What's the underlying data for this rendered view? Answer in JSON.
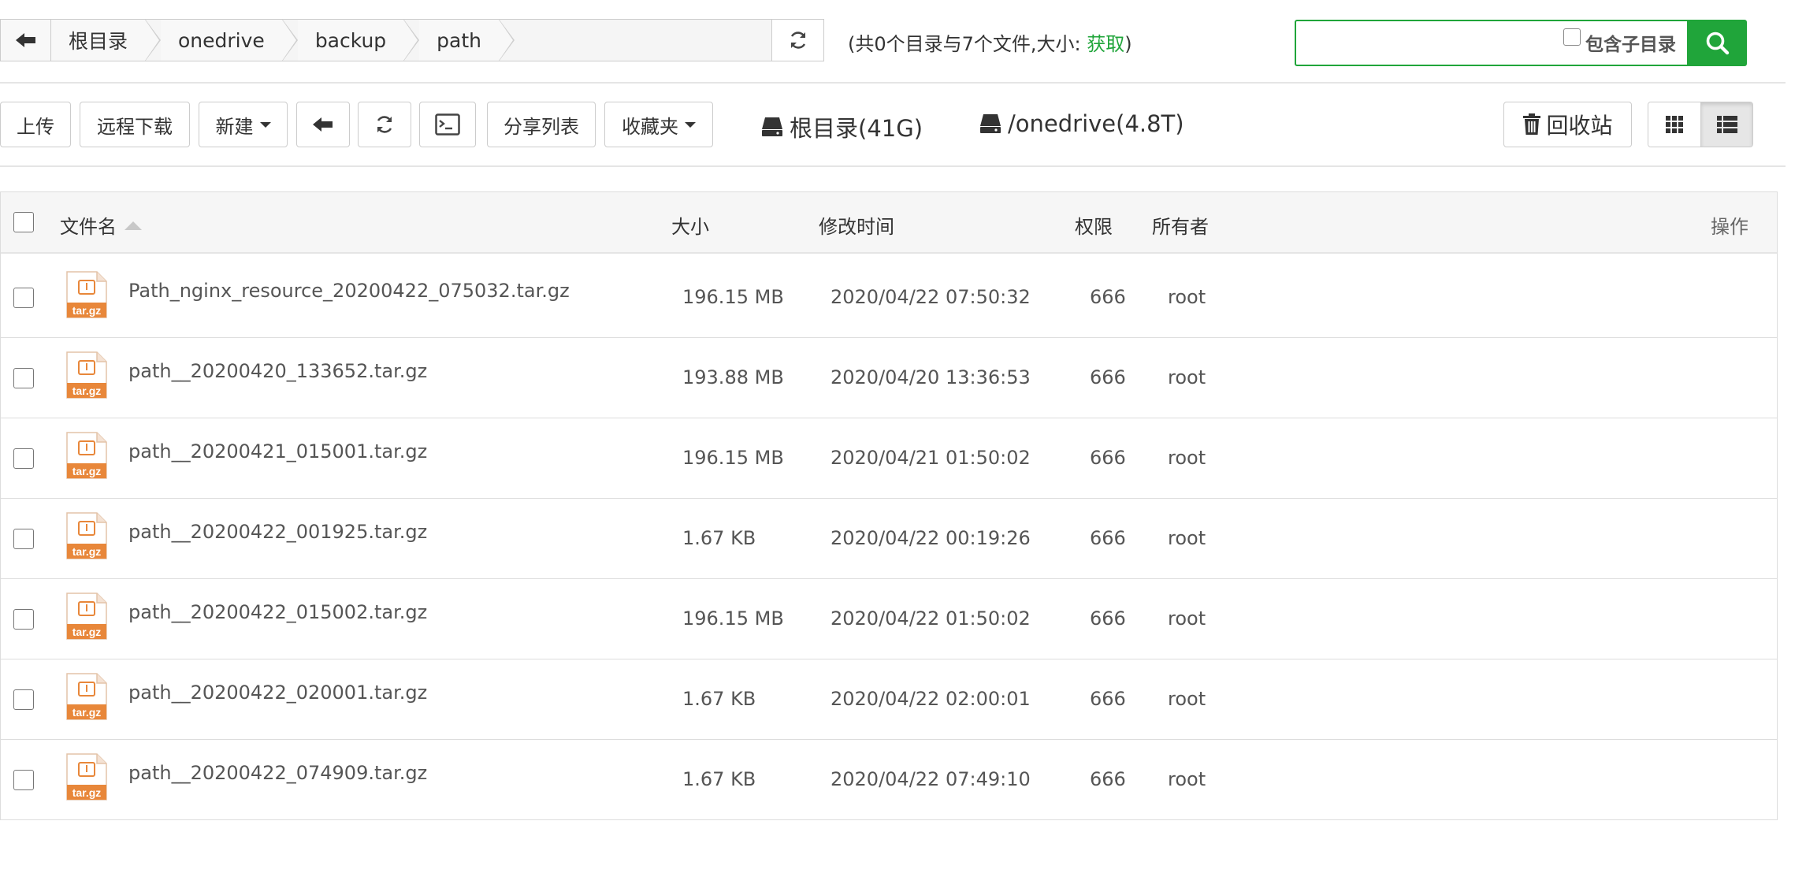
{
  "path": {
    "crumbs": [
      "根目录",
      "onedrive",
      "backup",
      "path"
    ]
  },
  "summary": {
    "prefix": "(共0个目录与7个文件,大小: ",
    "link": "获取",
    "suffix": ")"
  },
  "search": {
    "value": "",
    "subdir_label": "包含子目录"
  },
  "toolbar": {
    "upload": "上传",
    "remote_download": "远程下载",
    "new": "新建",
    "share_list": "分享列表",
    "favorites": "收藏夹",
    "recycle_bin": "回收站"
  },
  "disks": [
    {
      "label": "根目录(41G)"
    },
    {
      "label": "/onedrive(4.8T)"
    }
  ],
  "table": {
    "headers": {
      "name": "文件名",
      "size": "大小",
      "mtime": "修改时间",
      "perm": "权限",
      "owner": "所有者",
      "ops": "操作"
    },
    "rows": [
      {
        "name": "Path_nginx_resource_20200422_075032.tar.gz",
        "size": "196.15 MB",
        "mtime": "2020/04/22 07:50:32",
        "perm": "666",
        "owner": "root"
      },
      {
        "name": "path__20200420_133652.tar.gz",
        "size": "193.88 MB",
        "mtime": "2020/04/20 13:36:53",
        "perm": "666",
        "owner": "root"
      },
      {
        "name": "path__20200421_015001.tar.gz",
        "size": "196.15 MB",
        "mtime": "2020/04/21 01:50:02",
        "perm": "666",
        "owner": "root"
      },
      {
        "name": "path__20200422_001925.tar.gz",
        "size": "1.67 KB",
        "mtime": "2020/04/22 00:19:26",
        "perm": "666",
        "owner": "root"
      },
      {
        "name": "path__20200422_015002.tar.gz",
        "size": "196.15 MB",
        "mtime": "2020/04/22 01:50:02",
        "perm": "666",
        "owner": "root"
      },
      {
        "name": "path__20200422_020001.tar.gz",
        "size": "1.67 KB",
        "mtime": "2020/04/22 02:00:01",
        "perm": "666",
        "owner": "root"
      },
      {
        "name": "path__20200422_074909.tar.gz",
        "size": "1.67 KB",
        "mtime": "2020/04/22 07:49:10",
        "perm": "666",
        "owner": "root"
      }
    ],
    "file_icon": "tar-gz-archive-icon",
    "file_icon_text": "tar.gz"
  },
  "colors": {
    "accent": "#20a53a",
    "archive_icon": "#e8873a"
  }
}
